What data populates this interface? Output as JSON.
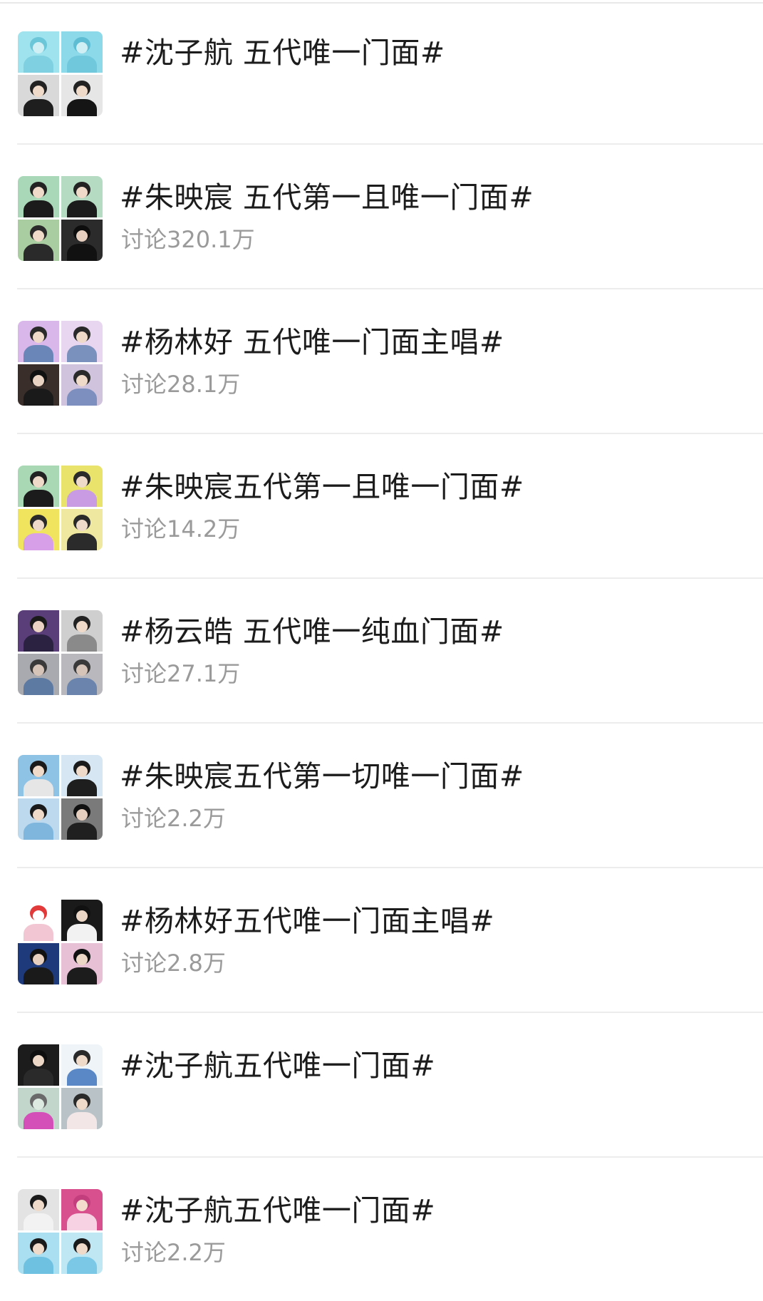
{
  "topics": [
    {
      "title": "#沈子航 五代唯一门面#",
      "count": "",
      "thumb": [
        {
          "bg": "#9fe3ef",
          "body": "#7fd0e0",
          "hair": "#6bc6d8",
          "skin": "#cfeff5"
        },
        {
          "bg": "#8cd9e9",
          "body": "#70c8dd",
          "hair": "#5fbdd3",
          "skin": "#cfeff5"
        },
        {
          "bg": "#d9d9d9",
          "body": "#1e1e1e",
          "hair": "#222222",
          "skin": "#efd9c8"
        },
        {
          "bg": "#e6e6e6",
          "body": "#151515",
          "hair": "#222222",
          "skin": "#efd9c8"
        }
      ]
    },
    {
      "title": "#朱映宸 五代第一且唯一门面#",
      "count": "讨论320.1万",
      "thumb": [
        {
          "bg": "#a8d8b8",
          "body": "#1b1b1b",
          "hair": "#222222",
          "skin": "#efd9c8"
        },
        {
          "bg": "#b5dcc2",
          "body": "#1b1b1b",
          "hair": "#222222",
          "skin": "#efd9c8"
        },
        {
          "bg": "#a9cda0",
          "body": "#2a2a2a",
          "hair": "#2a2a2a",
          "skin": "#efd9c8"
        },
        {
          "bg": "#2b2b2b",
          "body": "#111111",
          "hair": "#0d0d0d",
          "skin": "#e6cfbf"
        }
      ]
    },
    {
      "title": "#杨林好 五代唯一门面主唱#",
      "count": "讨论28.1万",
      "thumb": [
        {
          "bg": "#d9b7ea",
          "body": "#6a86b8",
          "hair": "#2a2a2a",
          "skin": "#efd9c8"
        },
        {
          "bg": "#e8d5ef",
          "body": "#7a90bd",
          "hair": "#2a2a2a",
          "skin": "#efd9c8"
        },
        {
          "bg": "#3a2e2a",
          "body": "#1a1a1a",
          "hair": "#111111",
          "skin": "#e9d2c1"
        },
        {
          "bg": "#cfc3dd",
          "body": "#7d8fbf",
          "hair": "#2a2a2a",
          "skin": "#efd9c8"
        }
      ]
    },
    {
      "title": "#朱映宸五代第一且唯一门面#",
      "count": "讨论14.2万",
      "thumb": [
        {
          "bg": "#a9d8b5",
          "body": "#1b1b1b",
          "hair": "#222222",
          "skin": "#efd9c8"
        },
        {
          "bg": "#e9e36c",
          "body": "#c89be2",
          "hair": "#2a2a2a",
          "skin": "#efd9c8"
        },
        {
          "bg": "#f0e45e",
          "body": "#d79fe8",
          "hair": "#2a2a2a",
          "skin": "#efd9c8"
        },
        {
          "bg": "#efe8a0",
          "body": "#2b2b2b",
          "hair": "#2a2a2a",
          "skin": "#efd9c8"
        }
      ]
    },
    {
      "title": "#杨云皓 五代唯一纯血门面#",
      "count": "讨论27.1万",
      "thumb": [
        {
          "bg": "#5a3e7a",
          "body": "#2a2240",
          "hair": "#1a1a1a",
          "skin": "#ead3c3"
        },
        {
          "bg": "#cfcfcf",
          "body": "#8a8a8a",
          "hair": "#222222",
          "skin": "#efd9c8"
        },
        {
          "bg": "#a9a9b0",
          "body": "#5d7aa3",
          "hair": "#3a3a3a",
          "skin": "#d7c4b8"
        },
        {
          "bg": "#b8b8bd",
          "body": "#6a84ad",
          "hair": "#3a3a3a",
          "skin": "#d7c4b8"
        }
      ]
    },
    {
      "title": "#朱映宸五代第一切唯一门面#",
      "count": "讨论2.2万",
      "thumb": [
        {
          "bg": "#8fc3e6",
          "body": "#e6e6e6",
          "hair": "#1a1a1a",
          "skin": "#efd9c8"
        },
        {
          "bg": "#d6e6f2",
          "body": "#1e1e1e",
          "hair": "#1a1a1a",
          "skin": "#efd9c8"
        },
        {
          "bg": "#bcd9ee",
          "body": "#7fb6dd",
          "hair": "#1a1a1a",
          "skin": "#efd9c8"
        },
        {
          "bg": "#7a7a7a",
          "body": "#202020",
          "hair": "#111111",
          "skin": "#e6cfbf"
        }
      ]
    },
    {
      "title": "#杨林好五代唯一门面主唱#",
      "count": "讨论2.8万",
      "thumb": [
        {
          "bg": "#ffffff",
          "body": "#f3c6d3",
          "hair": "#e23a3a",
          "skin": "#ffffff"
        },
        {
          "bg": "#1a1a1a",
          "body": "#f2f2f2",
          "hair": "#111111",
          "skin": "#ecd6c6"
        },
        {
          "bg": "#1f3a7a",
          "body": "#1a1a1a",
          "hair": "#111111",
          "skin": "#e6cfbf"
        },
        {
          "bg": "#e7c0d6",
          "body": "#1c1c1c",
          "hair": "#111111",
          "skin": "#ecd6c6"
        }
      ]
    },
    {
      "title": "#沈子航五代唯一门面#",
      "count": "",
      "thumb": [
        {
          "bg": "#1c1c1c",
          "body": "#2a2a2a",
          "hair": "#0f0f0f",
          "skin": "#ecd6c6"
        },
        {
          "bg": "#eef4f8",
          "body": "#5a88c6",
          "hair": "#2a2a2a",
          "skin": "#efd9c8"
        },
        {
          "bg": "#c2d6cc",
          "body": "#d44fb8",
          "hair": "#6a6a6a",
          "skin": "#dceae2"
        },
        {
          "bg": "#b9c3c7",
          "body": "#f2e6e6",
          "hair": "#2a2a2a",
          "skin": "#efd9c8"
        }
      ]
    },
    {
      "title": "#沈子航五代唯一门面#",
      "count": "讨论2.2万",
      "thumb": [
        {
          "bg": "#e3e3e3",
          "body": "#f2f2f2",
          "hair": "#1a1a1a",
          "skin": "#efd9c8"
        },
        {
          "bg": "#d9508e",
          "body": "#f6d2e2",
          "hair": "#c23e7c",
          "skin": "#f3dccb"
        },
        {
          "bg": "#a9dff0",
          "body": "#6fc1e1",
          "hair": "#1a1a1a",
          "skin": "#efd9c8"
        },
        {
          "bg": "#bfe6f3",
          "body": "#7ac8e6",
          "hair": "#1a1a1a",
          "skin": "#efd9c8"
        }
      ]
    }
  ]
}
